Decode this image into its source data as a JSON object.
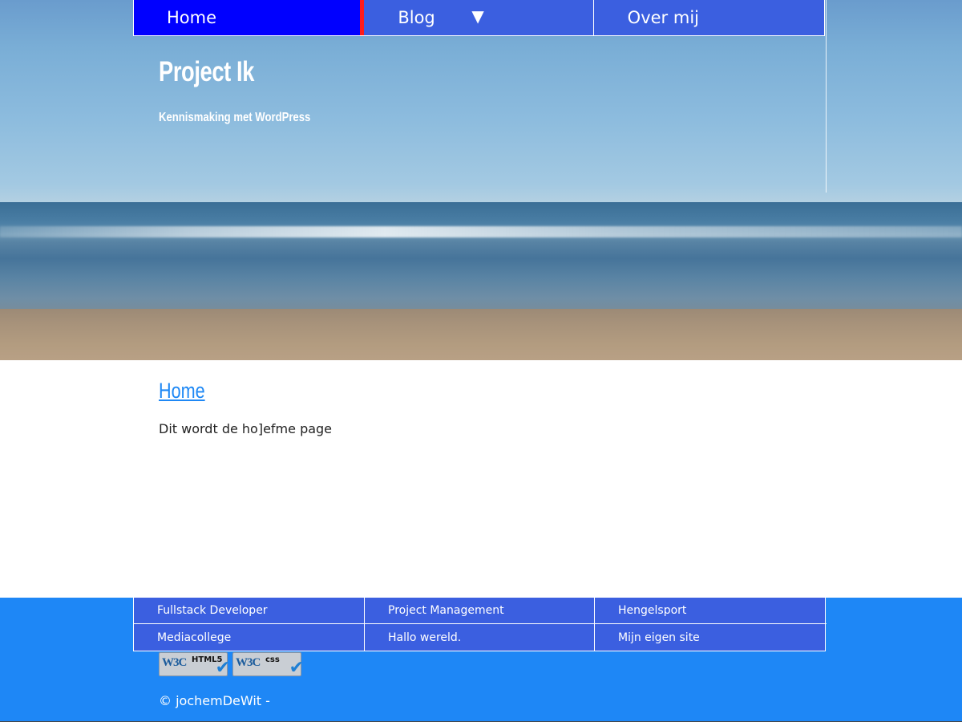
{
  "nav": {
    "items": [
      {
        "label": "Home"
      },
      {
        "label": "Blog"
      },
      {
        "label": "Over mij"
      }
    ],
    "dropdown_glyph": "▼"
  },
  "site": {
    "title": "Project Ik",
    "tagline": "Kennismaking met WordPress"
  },
  "main": {
    "heading": "Home",
    "body": "Dit wordt de ho]efme page"
  },
  "footer": {
    "links": [
      "Fullstack Developer",
      "Project Management",
      "Hengelsport",
      "Mediacollege",
      "Hallo wereld.",
      "Mijn eigen site"
    ],
    "badges": [
      {
        "brand": "W3C",
        "kind": "HTML5"
      },
      {
        "brand": "W3C",
        "kind": "css"
      }
    ],
    "copyright": "© jochemDeWit -"
  },
  "colors": {
    "nav_bg": "#3b5fe0",
    "nav_active_bg": "#0000ff",
    "nav_active_marker": "#ff1a1a",
    "link": "#1e88f5",
    "footer_bg": "#1e87f6"
  },
  "icons": [
    "chevron-down-icon",
    "w3c-html5-badge",
    "w3c-css-badge"
  ]
}
